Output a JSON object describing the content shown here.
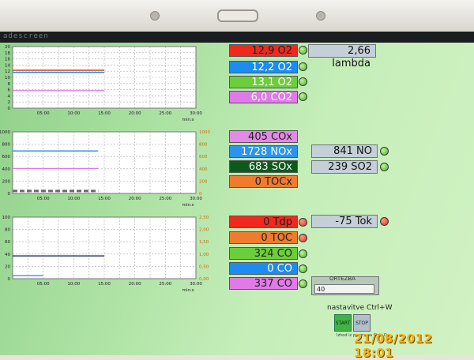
{
  "window": {
    "title": "adescreen"
  },
  "readings_top": [
    {
      "value": "12,9 O2",
      "color": "#f0281e",
      "led": "green"
    },
    {
      "value": "12,2 O2",
      "color": "#1d8cf0",
      "led": "green"
    },
    {
      "value": "13,1 O2",
      "color": "#6cce3a",
      "led": "green"
    },
    {
      "value": "6,0 CO2",
      "color": "#e07ae8",
      "led": "green"
    }
  ],
  "lambda": {
    "value": "2,66 lambda"
  },
  "readings_mid": [
    {
      "value": "405 COx",
      "color": "#e28ae6",
      "led": ""
    },
    {
      "value": "1728 NOx",
      "color": "#2d93ee",
      "led": ""
    },
    {
      "value": "683 SOx",
      "color": "#0d5b1c",
      "led": ""
    },
    {
      "value": "0 TOCx",
      "color": "#f07a2e",
      "led": ""
    }
  ],
  "gas_mid": [
    {
      "value": "841 NO",
      "led": "green"
    },
    {
      "value": "239 SO2",
      "led": "green"
    }
  ],
  "readings_bottom": [
    {
      "value": "0 Tdp",
      "color": "#f0281e",
      "led": "red"
    },
    {
      "value": "0 TOC",
      "color": "#f07a2e",
      "led": "red"
    },
    {
      "value": "324 CO",
      "color": "#6cce3a",
      "led": "green"
    },
    {
      "value": "0 CO",
      "color": "#1d8cf0",
      "led": "green"
    },
    {
      "value": "337 CO",
      "color": "#e07ae8",
      "led": "green"
    }
  ],
  "tok": {
    "value": "-75 Tok",
    "led": "red"
  },
  "ortezba": {
    "label": "ORTEZBA",
    "value": "40"
  },
  "settings_hint": "nastavitve Ctrl+W",
  "start_label": "START",
  "stop_label": "STOP",
  "exit_hint": "Izhod iz programa Ctrl+Q",
  "timestamp": "21/08/2012 18:01",
  "chart_data": [
    {
      "type": "line",
      "xlabel": "min:s",
      "x_ticks": [
        "05:00",
        "10:00",
        "15:00",
        "20:00",
        "25:00",
        "30:00"
      ],
      "xlim": [
        0,
        30
      ],
      "y_ticks_left": [
        "0",
        "2",
        "4",
        "6",
        "8",
        "10",
        "12",
        "14",
        "16",
        "18",
        "20"
      ],
      "ylim": [
        0,
        21
      ],
      "grid": true,
      "series": [
        {
          "color": "#1d8cf0",
          "x": [
            0,
            15
          ],
          "y": [
            12.2,
            12.2
          ]
        },
        {
          "color": "#f0281e",
          "x": [
            0,
            15
          ],
          "y": [
            12.9,
            12.9
          ]
        },
        {
          "color": "#6cce3a",
          "x": [
            0,
            15
          ],
          "y": [
            13.1,
            13.1
          ]
        },
        {
          "color": "#e07ae8",
          "x": [
            0,
            15
          ],
          "y": [
            6.0,
            6.0
          ]
        }
      ]
    },
    {
      "type": "line",
      "xlabel": "min:s",
      "x_ticks": [
        "05:00",
        "10:00",
        "15:00",
        "20:00",
        "25:00",
        "30:00"
      ],
      "xlim": [
        0,
        30
      ],
      "y_ticks_left": [
        "0",
        "200",
        "400",
        "600",
        "800",
        "1000"
      ],
      "y_ticks_right": [
        "0",
        "200",
        "400",
        "600",
        "800",
        "1000"
      ],
      "ylim": [
        0,
        1000
      ],
      "grid": true,
      "series": [
        {
          "color": "#1d8cf0",
          "x": [
            0,
            14
          ],
          "y": [
            690,
            690
          ]
        },
        {
          "color": "#e07ae8",
          "x": [
            0,
            14
          ],
          "y": [
            405,
            405
          ]
        },
        {
          "color": "#6a6a6a",
          "x": [
            0,
            14
          ],
          "y": [
            40,
            40
          ],
          "dashed": true
        }
      ]
    },
    {
      "type": "line",
      "xlabel": "min:s",
      "x_ticks": [
        "05:00",
        "10:00",
        "15:00",
        "20:00",
        "25:00",
        "30:00"
      ],
      "xlim": [
        0,
        30
      ],
      "y_ticks_left": [
        "0",
        "20",
        "40",
        "60",
        "80",
        "100"
      ],
      "y_ticks_right": [
        "0,00",
        "0,50",
        "1,00",
        "1,50",
        "2,00",
        "2,50"
      ],
      "ylim": [
        0,
        100
      ],
      "grid": true,
      "series": [
        {
          "color": "#101050",
          "x": [
            0,
            15
          ],
          "y": [
            37,
            37
          ]
        },
        {
          "color": "#1d8cf0",
          "x": [
            0,
            5
          ],
          "y": [
            5,
            5
          ]
        }
      ]
    }
  ]
}
